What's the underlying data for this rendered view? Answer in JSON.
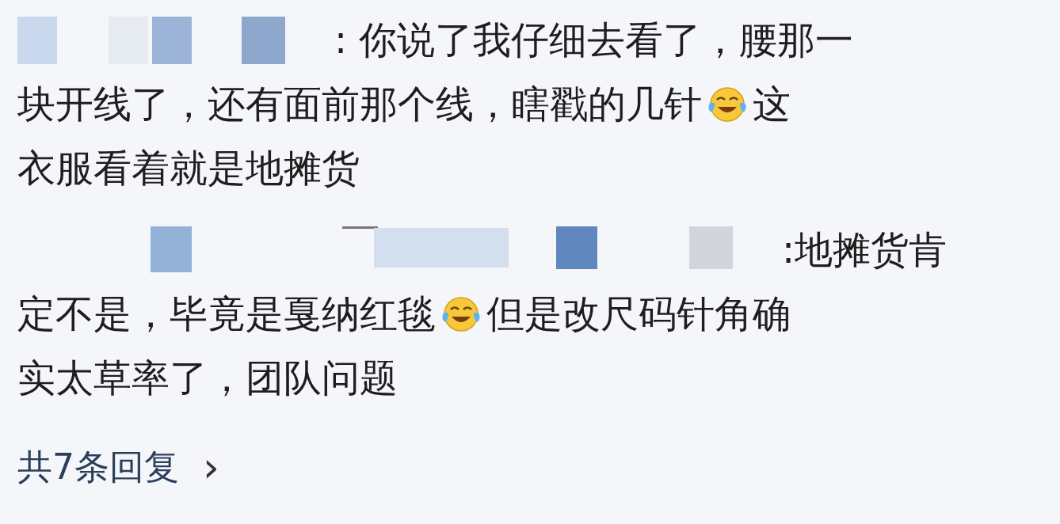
{
  "comments": [
    {
      "lines": [
        [
          {
            "kind": "text",
            "text": ": 你说了我仔细去看了，腰那一"
          }
        ],
        [
          {
            "kind": "text",
            "text": "块开线了，还有面前那个线，瞎戳的几针"
          },
          {
            "kind": "emoji"
          },
          {
            "kind": "text",
            "text": "这"
          }
        ],
        [
          {
            "kind": "text",
            "text": "衣服看着就是地摊货"
          }
        ]
      ]
    },
    {
      "lines": [
        [
          {
            "kind": "text",
            "text": ":地摊货肯"
          }
        ],
        [
          {
            "kind": "text",
            "text": "定不是，毕竟是戛纳红毯"
          },
          {
            "kind": "emoji"
          },
          {
            "kind": "text",
            "text": "但是改尺码针角确"
          }
        ],
        [
          {
            "kind": "text",
            "text": "实太草率了，团队问题"
          }
        ]
      ]
    }
  ],
  "replies_link": {
    "text": "共7条回复",
    "arrow": "›"
  }
}
